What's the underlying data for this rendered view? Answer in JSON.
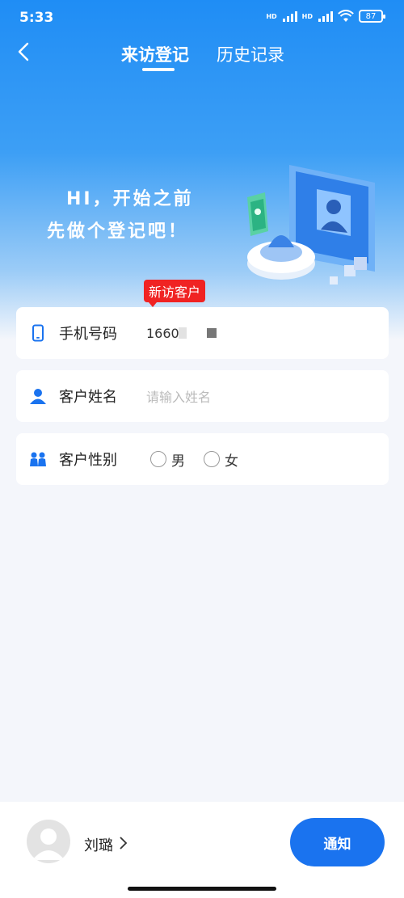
{
  "status_bar": {
    "time": "5:33",
    "battery": "87",
    "hd_label": "HD"
  },
  "nav": {
    "tabs": [
      {
        "label": "来访登记",
        "active": true
      },
      {
        "label": "历史记录",
        "active": false
      }
    ]
  },
  "hero": {
    "line1": "HI，开始之前",
    "line2": "先做个登记吧！"
  },
  "badge": "新访客户",
  "form": {
    "phone": {
      "label": "手机号码",
      "value": "1660"
    },
    "name": {
      "label": "客户姓名",
      "placeholder": "请输入姓名"
    },
    "gender": {
      "label": "客户性别",
      "options": [
        "男",
        "女"
      ]
    }
  },
  "footer": {
    "user_name": "刘璐",
    "notify_label": "通知"
  },
  "colors": {
    "primary": "#1a73ef",
    "badge": "#f02323",
    "hero_top": "#1f8df5"
  },
  "icons": [
    "back-icon",
    "phone-icon",
    "user-icon",
    "people-icon",
    "chevron-right-icon",
    "avatar-icon"
  ]
}
